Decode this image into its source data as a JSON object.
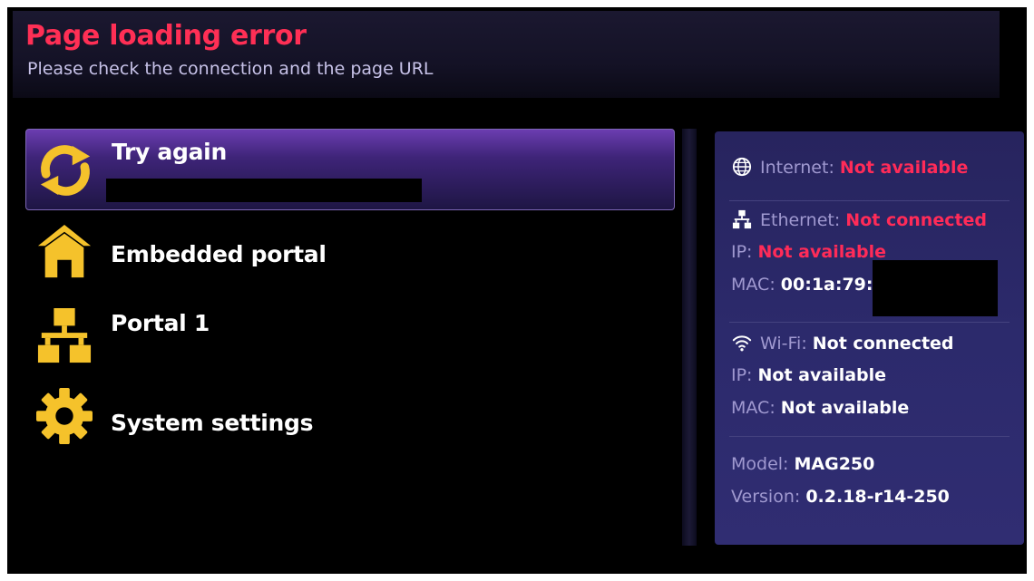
{
  "header": {
    "title": "Page loading error",
    "subtitle": "Please check the connection and the page URL"
  },
  "menu": [
    {
      "label": "Try again",
      "icon": "refresh-icon",
      "selected": true
    },
    {
      "label": "Embedded portal",
      "icon": "home-icon",
      "selected": false
    },
    {
      "label": "Portal 1",
      "icon": "network-icon",
      "selected": false
    },
    {
      "label": "System settings",
      "icon": "gear-icon",
      "selected": false
    }
  ],
  "status": {
    "internet": {
      "label": "Internet:",
      "value": "Not available"
    },
    "ethernet": {
      "label": "Ethernet:",
      "value": "Not connected",
      "ip_label": "IP:",
      "ip_value": "Not available",
      "mac_label": "MAC:",
      "mac_value": "00:1a:79:"
    },
    "wifi": {
      "label": "Wi-Fi:",
      "value": "Not connected",
      "ip_label": "IP:",
      "ip_value": "Not available",
      "mac_label": "MAC:",
      "mac_value": "Not available"
    },
    "model_label": "Model:",
    "model_value": "MAG250",
    "version_label": "Version:",
    "version_value": "0.2.18-r14-250"
  },
  "colors": {
    "error": "#ff2b58",
    "icon_yellow": "#f5c22b",
    "panel_background": "#2c2a6c",
    "selection": "#4a2c8c"
  }
}
